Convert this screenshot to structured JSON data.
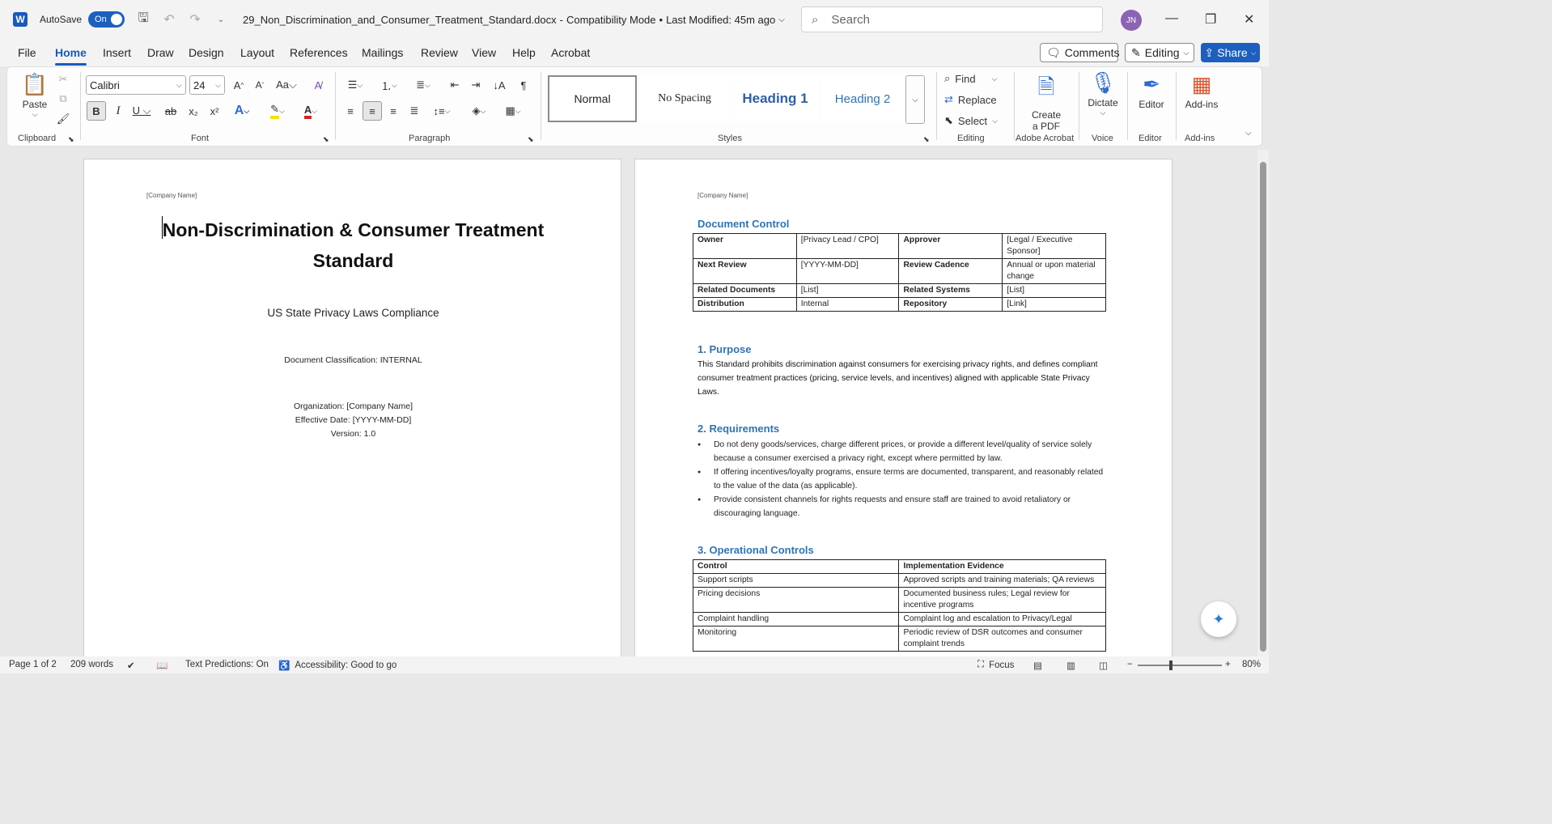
{
  "titlebar": {
    "autosave_label": "AutoSave",
    "autosave_state": "On",
    "document_title": "29_Non_Discrimination_and_Consumer_Treatment_Standard.docx",
    "separator": "-",
    "mode": "Compatibility Mode",
    "bullet": "•",
    "last_modified": "Last Modified: 45m ago",
    "search_placeholder": "Search",
    "avatar_initials": "JN"
  },
  "menu": {
    "items": [
      "File",
      "Home",
      "Insert",
      "Draw",
      "Design",
      "Layout",
      "References",
      "Mailings",
      "Review",
      "View",
      "Help",
      "Acrobat"
    ],
    "active": "Home",
    "comments_label": "Comments",
    "editing_label": "Editing",
    "share_label": "Share"
  },
  "ribbon": {
    "paste_label": "Paste",
    "font_name": "Calibri",
    "font_size": "24",
    "styles": [
      "Normal",
      "No Spacing",
      "Heading 1",
      "Heading 2"
    ],
    "find_label": "Find",
    "replace_label": "Replace",
    "select_label": "Select",
    "create_pdf_label_1": "Create",
    "create_pdf_label_2": "a PDF",
    "dictate_label": "Dictate",
    "editor_label": "Editor",
    "addins_label": "Add-ins",
    "groups": {
      "clipboard": "Clipboard",
      "font": "Font",
      "paragraph": "Paragraph",
      "styles": "Styles",
      "editing": "Editing",
      "adobe": "Adobe Acrobat",
      "voice": "Voice",
      "editor": "Editor",
      "addins": "Add-ins"
    }
  },
  "page1": {
    "company": "[Company Name]",
    "title_line1": "Non-Discrimination & Consumer Treatment",
    "title_line2": "Standard",
    "subtitle": "US State Privacy Laws Compliance",
    "classification": "Document Classification: INTERNAL",
    "organization": "Organization: [Company Name]",
    "effective_date": "Effective Date: [YYYY-MM-DD]",
    "version": "Version: 1.0"
  },
  "page2": {
    "company": "[Company Name]",
    "doc_control_heading": "Document Control",
    "doc_control_rows": [
      [
        "Owner",
        "[Privacy Lead / CPO]",
        "Approver",
        "[Legal / Executive Sponsor]"
      ],
      [
        "Next Review",
        "[YYYY-MM-DD]",
        "Review Cadence",
        "Annual or upon material change"
      ],
      [
        "Related Documents",
        "[List]",
        "Related Systems",
        "[List]"
      ],
      [
        "Distribution",
        "Internal",
        "Repository",
        "[Link]"
      ]
    ],
    "purpose_heading": "1. Purpose",
    "purpose_text": "This Standard prohibits discrimination against consumers for exercising privacy rights, and defines compliant consumer treatment practices (pricing, service levels, and incentives) aligned with applicable State Privacy Laws.",
    "requirements_heading": "2. Requirements",
    "requirements": [
      "Do not deny goods/services, charge different prices, or provide a different level/quality of service solely because a consumer exercised a privacy right, except where permitted by law.",
      "If offering incentives/loyalty programs, ensure terms are documented, transparent, and reasonably related to the value of the data (as applicable).",
      "Provide consistent channels for rights requests and ensure staff are trained to avoid retaliatory or discouraging language."
    ],
    "controls_heading": "3. Operational Controls",
    "controls_header": [
      "Control",
      "Implementation Evidence"
    ],
    "controls_rows": [
      [
        "Support scripts",
        "Approved scripts and training materials; QA reviews"
      ],
      [
        "Pricing decisions",
        "Documented business rules; Legal review for incentive programs"
      ],
      [
        "Complaint handling",
        "Complaint log and escalation to Privacy/Legal"
      ],
      [
        "Monitoring",
        "Periodic review of DSR outcomes and consumer complaint trends"
      ]
    ]
  },
  "status": {
    "page": "Page 1 of 2",
    "words": "209 words",
    "text_predictions": "Text Predictions: On",
    "accessibility": "Accessibility: Good to go",
    "focus": "Focus",
    "zoom_minus": "−",
    "zoom_plus": "+",
    "zoom": "80%"
  }
}
